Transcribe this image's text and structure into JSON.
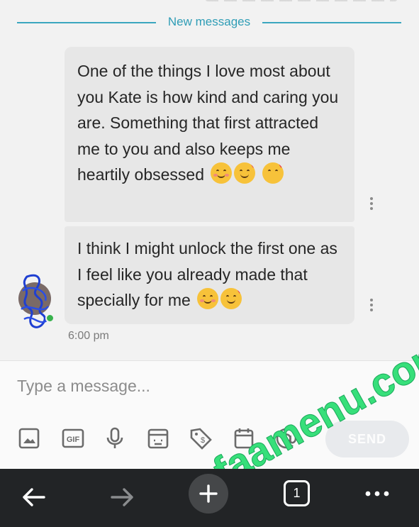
{
  "divider": {
    "label": "New messages"
  },
  "messages": [
    {
      "text": "One of the things I love most about you Kate is how kind and caring you are. Something that first attracted me to you and also keeps me heartily obsessed",
      "emojis": [
        "smiling-face-icon",
        "smiling-face-with-hearts-icon",
        "face-blowing-kiss-icon"
      ]
    },
    {
      "text": "I think I might unlock the first one as I feel like you already made that specially for me",
      "emojis": [
        "relieved-face-icon",
        "smiling-face-with-hearts-icon"
      ]
    }
  ],
  "timestamp": "6:00 pm",
  "composer": {
    "placeholder": "Type a message...",
    "send_label": "SEND",
    "tools": [
      "image-icon",
      "gif-icon",
      "microphone-icon",
      "sticker-icon",
      "price-tag-icon",
      "calendar-icon",
      "at-sign-icon"
    ],
    "gif_text": "GIF"
  },
  "watermark": "faamenu.com",
  "navbar": {
    "tab_count": "1"
  },
  "colors": {
    "accent": "#2f9db6",
    "bubble": "#e7e7e7",
    "online": "#37b24d",
    "watermark": "#37df7a",
    "navbar": "#222426"
  }
}
